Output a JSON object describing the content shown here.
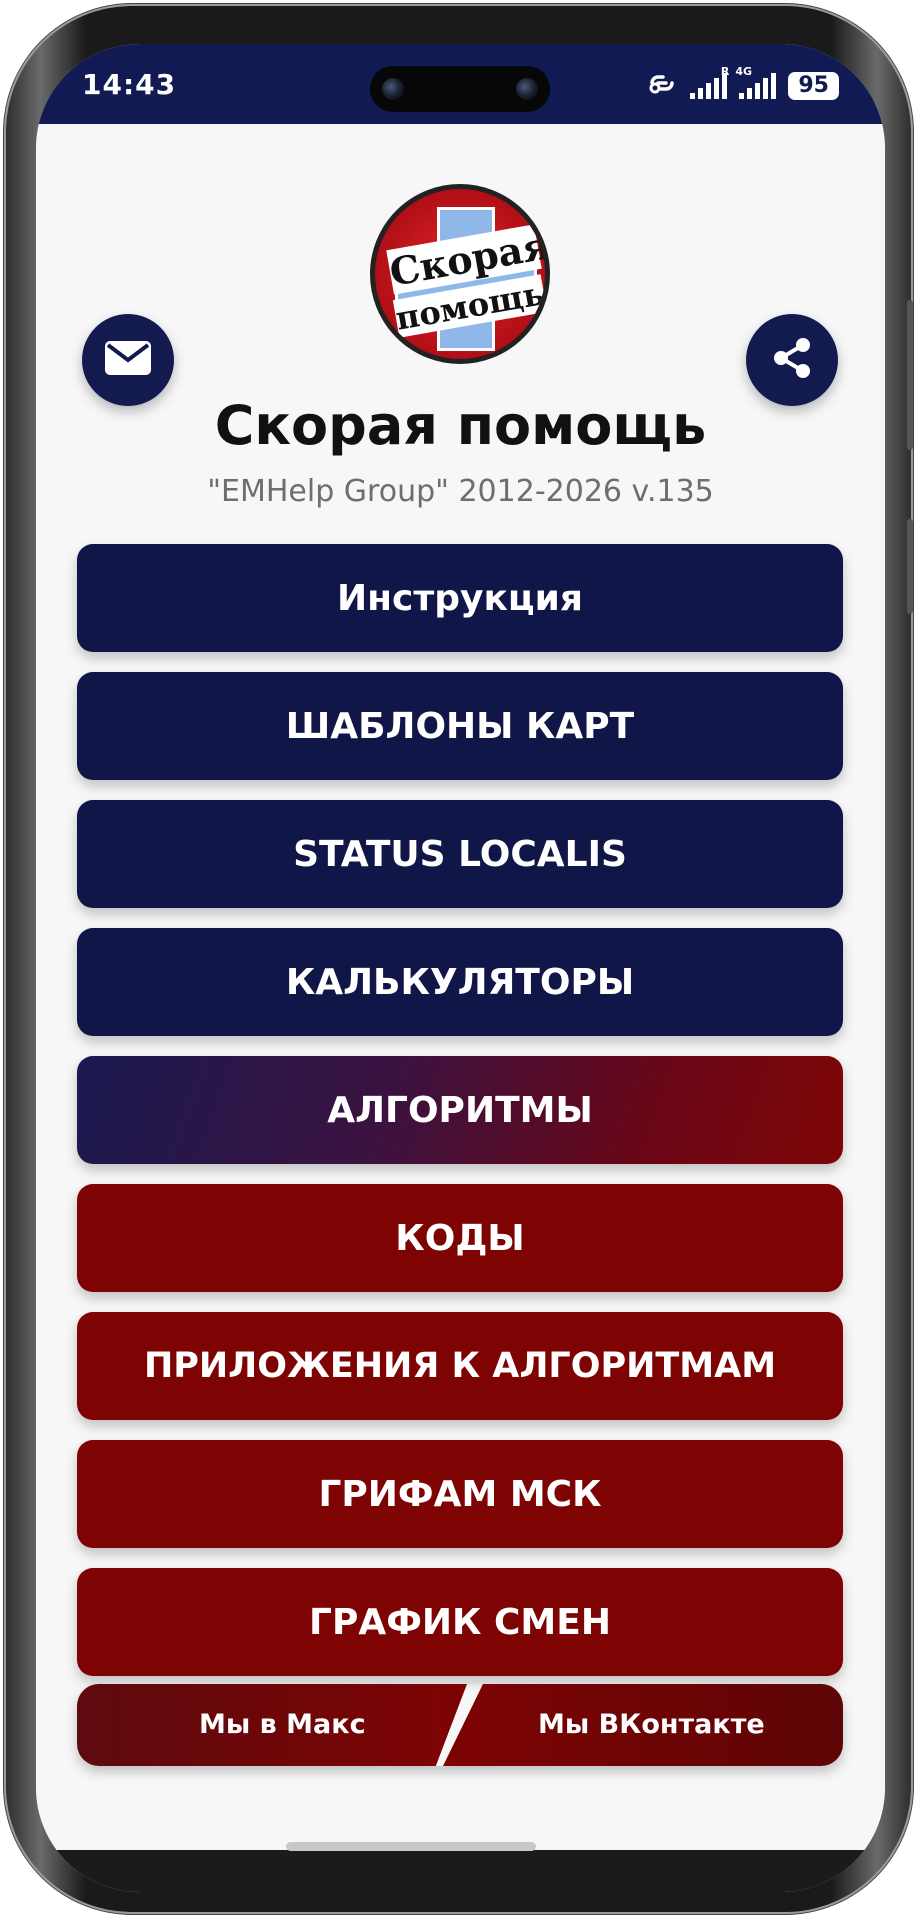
{
  "status_bar": {
    "time": "14:43",
    "signal1_tag": "R",
    "signal2_tag": "4G",
    "battery": "95"
  },
  "header": {
    "logo_text_line1": "Скорая",
    "logo_text_line2": "помощь",
    "title": "Скорая помощь",
    "subtitle": "\"EMHelp Group\" 2012-2026 v.135"
  },
  "menu": [
    {
      "label": "Инструкция"
    },
    {
      "label": "ШАБЛОНЫ КАРТ"
    },
    {
      "label": "STATUS LOCALIS"
    },
    {
      "label": "КАЛЬКУЛЯТОРЫ"
    },
    {
      "label": "АЛГОРИТМЫ"
    },
    {
      "label": "КОДЫ"
    },
    {
      "label": "ПРИЛОЖЕНИЯ К АЛГОРИТМАМ"
    },
    {
      "label": "ГРИФАМ МСК"
    },
    {
      "label": "ГРАФИК СМЕН"
    }
  ],
  "social": {
    "left": "Мы в Макс",
    "right": "Мы ВКонтакте"
  },
  "colors": {
    "navy": "#111649",
    "red": "#7e0303",
    "status_bar": "#111a52"
  },
  "icons": {
    "left_round_button": "mail-icon",
    "right_round_button": "share-icon"
  }
}
